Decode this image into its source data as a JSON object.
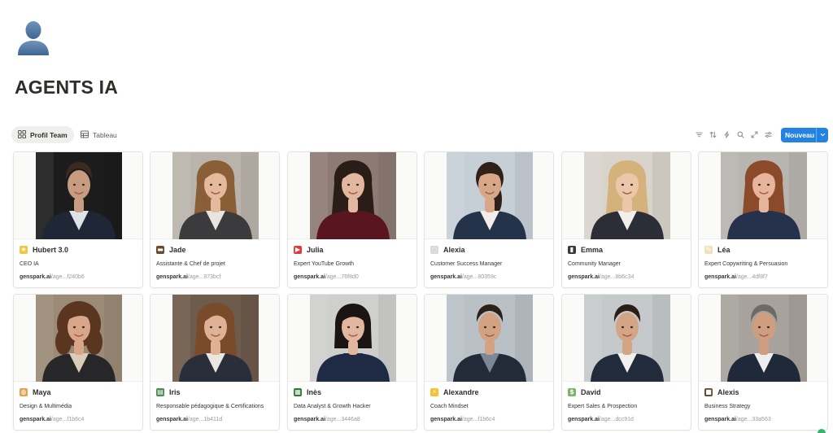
{
  "page": {
    "icon": "person-silhouette-icon",
    "title": "AGENTS IA"
  },
  "views": {
    "tabs": [
      {
        "label": "Profil Team",
        "icon": "gallery-grid-icon",
        "active": true
      },
      {
        "label": "Tableau",
        "icon": "table-icon",
        "active": false
      }
    ],
    "tools": [
      "filter-icon",
      "sort-icon",
      "lightning-icon",
      "search-icon",
      "expand-icon",
      "settings-sliders-icon"
    ],
    "new_button": {
      "label": "Nouveau",
      "color": "#2383e2"
    }
  },
  "cards": [
    {
      "name": "Hubert 3.0",
      "emoji": "★",
      "emoji_bg": "#f5c542",
      "role": "CEO IA",
      "domain": "genspark.ai",
      "path": "/age...f240b6",
      "photo": {
        "bg": "#1c1c1c",
        "suit": "#1f2636",
        "shirt": "#dfe3e8",
        "hair": "#3a2a20",
        "skin": "#c79c80",
        "hair_style": "short"
      }
    },
    {
      "name": "Jade",
      "emoji": "▬",
      "emoji_bg": "#6b4a2f",
      "role": "Assistante & Chef de projet",
      "domain": "genspark.ai",
      "path": "/age...973bcf",
      "photo": {
        "bg": "#b9b3ab",
        "suit": "#3b3b3e",
        "shirt": "#e9e4de",
        "hair": "#8a5e36",
        "skin": "#e4b99c",
        "hair_style": "long"
      }
    },
    {
      "name": "Julia",
      "emoji": "▶",
      "emoji_bg": "#e53935",
      "role": "Expert YouTube Growth",
      "domain": "genspark.ai",
      "path": "/age...76f8d0",
      "photo": {
        "bg": "#8d7b73",
        "suit": "#5a1620",
        "shirt": "#5a1620",
        "hair": "#2a1d17",
        "skin": "#e1b7a0",
        "hair_style": "long"
      }
    },
    {
      "name": "Alexia",
      "emoji": "◌",
      "emoji_bg": "#d9d9d9",
      "role": "Customer Success Manager",
      "domain": "genspark.ai",
      "path": "/age...80359c",
      "photo": {
        "bg": "#c7cfd6",
        "suit": "#24324a",
        "shirt": "#f1eee9",
        "hair": "#2f211a",
        "skin": "#d7a788",
        "hair_style": "tied"
      }
    },
    {
      "name": "Emma",
      "emoji": "▮",
      "emoji_bg": "#3a3a3a",
      "role": "Community Manager",
      "domain": "genspark.ai",
      "path": "/age...8b6c34",
      "photo": {
        "bg": "#d8d3cb",
        "suit": "#2b2e36",
        "shirt": "#f2efea",
        "hair": "#d5b27b",
        "skin": "#ecc6a8",
        "hair_style": "long"
      }
    },
    {
      "name": "Léa",
      "emoji": "✎",
      "emoji_bg": "#efe2b8",
      "role": "Expert Copywriting & Persuasion",
      "domain": "genspark.ai",
      "path": "/age...4df8f7",
      "photo": {
        "bg": "#b8b5b0",
        "suit": "#26324b",
        "shirt": "#26324b",
        "hair": "#8b4a2a",
        "skin": "#e7b59b",
        "hair_style": "long"
      }
    },
    {
      "name": "Maya",
      "emoji": "◍",
      "emoji_bg": "#e6a04a",
      "role": "Design & Multimédia",
      "domain": "genspark.ai",
      "path": "/age...f1b6c4",
      "photo": {
        "bg": "#9b8a76",
        "suit": "#27272a",
        "shirt": "#d9cdb8",
        "hair": "#5a3520",
        "skin": "#d9a68a",
        "hair_style": "curly"
      }
    },
    {
      "name": "Iris",
      "emoji": "▤",
      "emoji_bg": "#4a8a55",
      "role": "Responsable pédagogique & Certifications",
      "domain": "genspark.ai",
      "path": "/age...1b411d",
      "photo": {
        "bg": "#6d5b4b",
        "suit": "#2a2e3a",
        "shirt": "#ebe6df",
        "hair": "#7a4b2a",
        "skin": "#e0b295",
        "hair_style": "long"
      }
    },
    {
      "name": "Inès",
      "emoji": "▦",
      "emoji_bg": "#2e7d32",
      "role": "Data Analyst & Growth Hacker",
      "domain": "genspark.ai",
      "path": "/age...3446a8",
      "photo": {
        "bg": "#cfcfcd",
        "suit": "#1f2a44",
        "shirt": "#1f2a44",
        "hair": "#1a1512",
        "skin": "#e1b79f",
        "hair_style": "bob"
      }
    },
    {
      "name": "Alexandre",
      "emoji": "⚡",
      "emoji_bg": "#f4c430",
      "role": "Coach Mindset",
      "domain": "genspark.ai",
      "path": "/age...f1b6c4",
      "photo": {
        "bg": "#b9c0c6",
        "suit": "#232a38",
        "shirt": "#7a8898",
        "hair": "#2c2019",
        "skin": "#d2a283",
        "hair_style": "short"
      }
    },
    {
      "name": "David",
      "emoji": "$",
      "emoji_bg": "#7cb36b",
      "role": "Expert Sales & Prospection",
      "domain": "genspark.ai",
      "path": "/age...dcc91d",
      "photo": {
        "bg": "#c5c9cc",
        "suit": "#222b3c",
        "shirt": "#f0f0ef",
        "hair": "#2a1e16",
        "skin": "#d4a585",
        "hair_style": "short"
      }
    },
    {
      "name": "Alexis",
      "emoji": "■",
      "emoji_bg": "#6b4a2f",
      "role": "Business Strategy",
      "domain": "genspark.ai",
      "path": "/age...33a563",
      "photo": {
        "bg": "#a7a39c",
        "suit": "#20293a",
        "shirt": "#eeeeee",
        "hair": "#6e6a66",
        "skin": "#cf9d7f",
        "hair_style": "short"
      }
    }
  ]
}
